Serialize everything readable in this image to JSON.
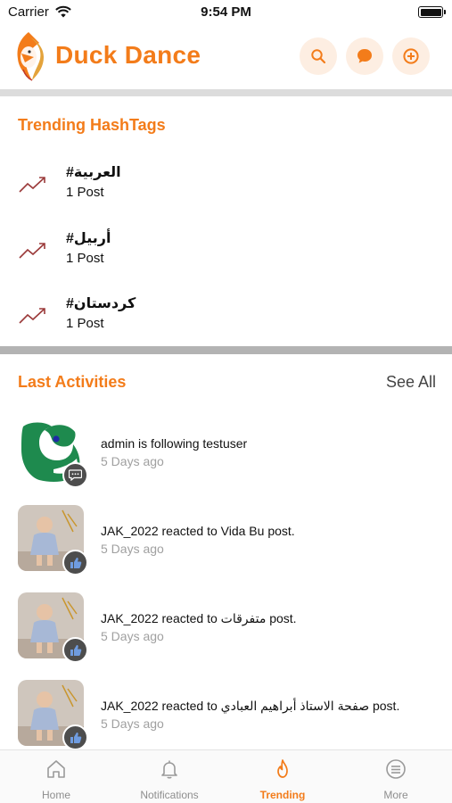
{
  "status_bar": {
    "carrier": "Carrier",
    "time": "9:54 PM"
  },
  "header": {
    "title": "Duck Dance",
    "accent_color": "#f37c1a",
    "icons": [
      "search-icon",
      "chat-icon",
      "add-circle-icon"
    ]
  },
  "trending": {
    "title": "Trending HashTags",
    "hashtags": [
      {
        "name": "#العربية",
        "count": "1 Post"
      },
      {
        "name": "#أربيل",
        "count": "1 Post"
      },
      {
        "name": "#كردستان",
        "count": "1 Post"
      }
    ]
  },
  "activities": {
    "title": "Last Activities",
    "see_all": "See All",
    "items": [
      {
        "text": "admin is following testuser",
        "time": "5 Days ago",
        "badge": "comment-icon"
      },
      {
        "text": "JAK_2022 reacted to Vida Bu post.",
        "time": "5 Days ago",
        "badge": "like-icon"
      },
      {
        "text": "JAK_2022 reacted to متفرقات post.",
        "time": "5 Days ago",
        "badge": "like-icon"
      },
      {
        "text": "JAK_2022 reacted to صفحة الاستاذ أبراهيم العبادي post.",
        "time": "5 Days ago",
        "badge": "like-icon"
      }
    ]
  },
  "tabs": [
    {
      "label": "Home",
      "icon": "home-icon",
      "active": false
    },
    {
      "label": "Notifications",
      "icon": "bell-icon",
      "active": false
    },
    {
      "label": "Trending",
      "icon": "flame-icon",
      "active": true
    },
    {
      "label": "More",
      "icon": "menu-icon",
      "active": false
    }
  ]
}
